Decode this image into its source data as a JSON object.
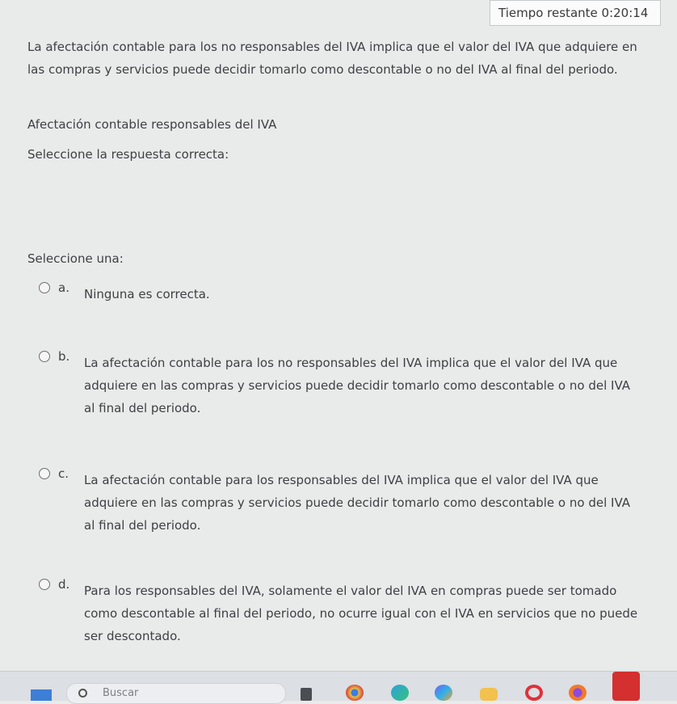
{
  "timer": {
    "label": "Tiempo restante",
    "value": "0:20:14"
  },
  "question": {
    "text": "La afectación contable para los no responsables del IVA implica que el valor del IVA que adquiere en las compras y servicios puede decidir tomarlo como descontable o no del IVA al final del periodo.",
    "title": "Afectación contable responsables del IVA",
    "prompt": "Seleccione la respuesta correcta:",
    "select_label": "Seleccione una:"
  },
  "options": [
    {
      "letter": "a.",
      "text": "Ninguna es correcta."
    },
    {
      "letter": "b.",
      "text": "La afectación contable para los no responsables del IVA implica que el valor del IVA que adquiere en las compras y servicios puede decidir tomarlo como descontable o no del IVA al final del periodo."
    },
    {
      "letter": "c.",
      "text": "La afectación contable para los responsables del IVA implica que el valor del IVA que adquiere en las compras y servicios puede decidir tomarlo como descontable o no del IVA al final del periodo."
    },
    {
      "letter": "d.",
      "text": "Para los responsables del IVA, solamente el valor del IVA en compras puede ser tomado como descontable al final del periodo, no ocurre igual con el IVA en servicios que no puede ser descontado."
    }
  ],
  "taskbar": {
    "search_placeholder": "Buscar",
    "icons": [
      "windows-start-icon",
      "search-icon",
      "task-view-icon",
      "chrome-icon",
      "edge-icon",
      "copilot-icon",
      "folder-icon",
      "opera-icon",
      "firefox-icon",
      "acrobat-icon"
    ]
  }
}
